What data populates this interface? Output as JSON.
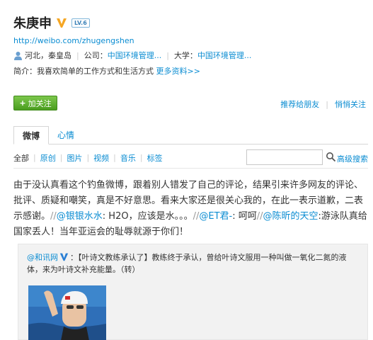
{
  "profile": {
    "name": "朱庚申",
    "level_badge": "LV.6",
    "url": "http://weibo.com/zhugengshen",
    "location": "河北，秦皇岛",
    "company_label": "公司：",
    "company": "中国环境管理...",
    "school_label": "大学：",
    "school": "中国环境管理...",
    "bio_label": "简介：",
    "bio": "我喜欢简单的工作方式和生活方式",
    "more_info": "更多资料>>"
  },
  "actions": {
    "follow_plus": "+",
    "follow_label": "加关注",
    "recommend": "推荐给朋友",
    "whisper": "悄悄关注"
  },
  "tabs": [
    {
      "label": "微博"
    },
    {
      "label": "心情"
    }
  ],
  "filters": [
    "全部",
    "原创",
    "图片",
    "视频",
    "音乐",
    "标签"
  ],
  "search": {
    "value": "",
    "placeholder": ""
  },
  "advanced_search": "高级搜索",
  "post": {
    "text1": "由于没认真看这个钓鱼微博，跟着别人错发了自己的评论，结果引来许多网友的评论、批评、质疑和嘲笑，真是不好意思。看来大家还是很关心我的，在此一表示道歉，二表示感谢。",
    "s1": "//",
    "at1": "@银银水水",
    "t2": ": H2O，应该是水。。。",
    "s2": "//",
    "at2": "@ET君-",
    "t3": ": 呵呵",
    "s3": "//",
    "at3": "@陈昕的天空",
    "t4": ":游泳队真给国家丢人！当年亚运会的耻辱就源于你们！"
  },
  "quote": {
    "author": "@和讯网",
    "text": "：【叶诗文教练承认了】教练终于承认，曾给叶诗文服用一种叫做一氧化二氮的液体，来为叶诗文补充能量。（转）"
  },
  "colors": {
    "link": "#0a8cd2",
    "follow_green": "#5aab2a",
    "verified_orange": "#f5a623"
  }
}
